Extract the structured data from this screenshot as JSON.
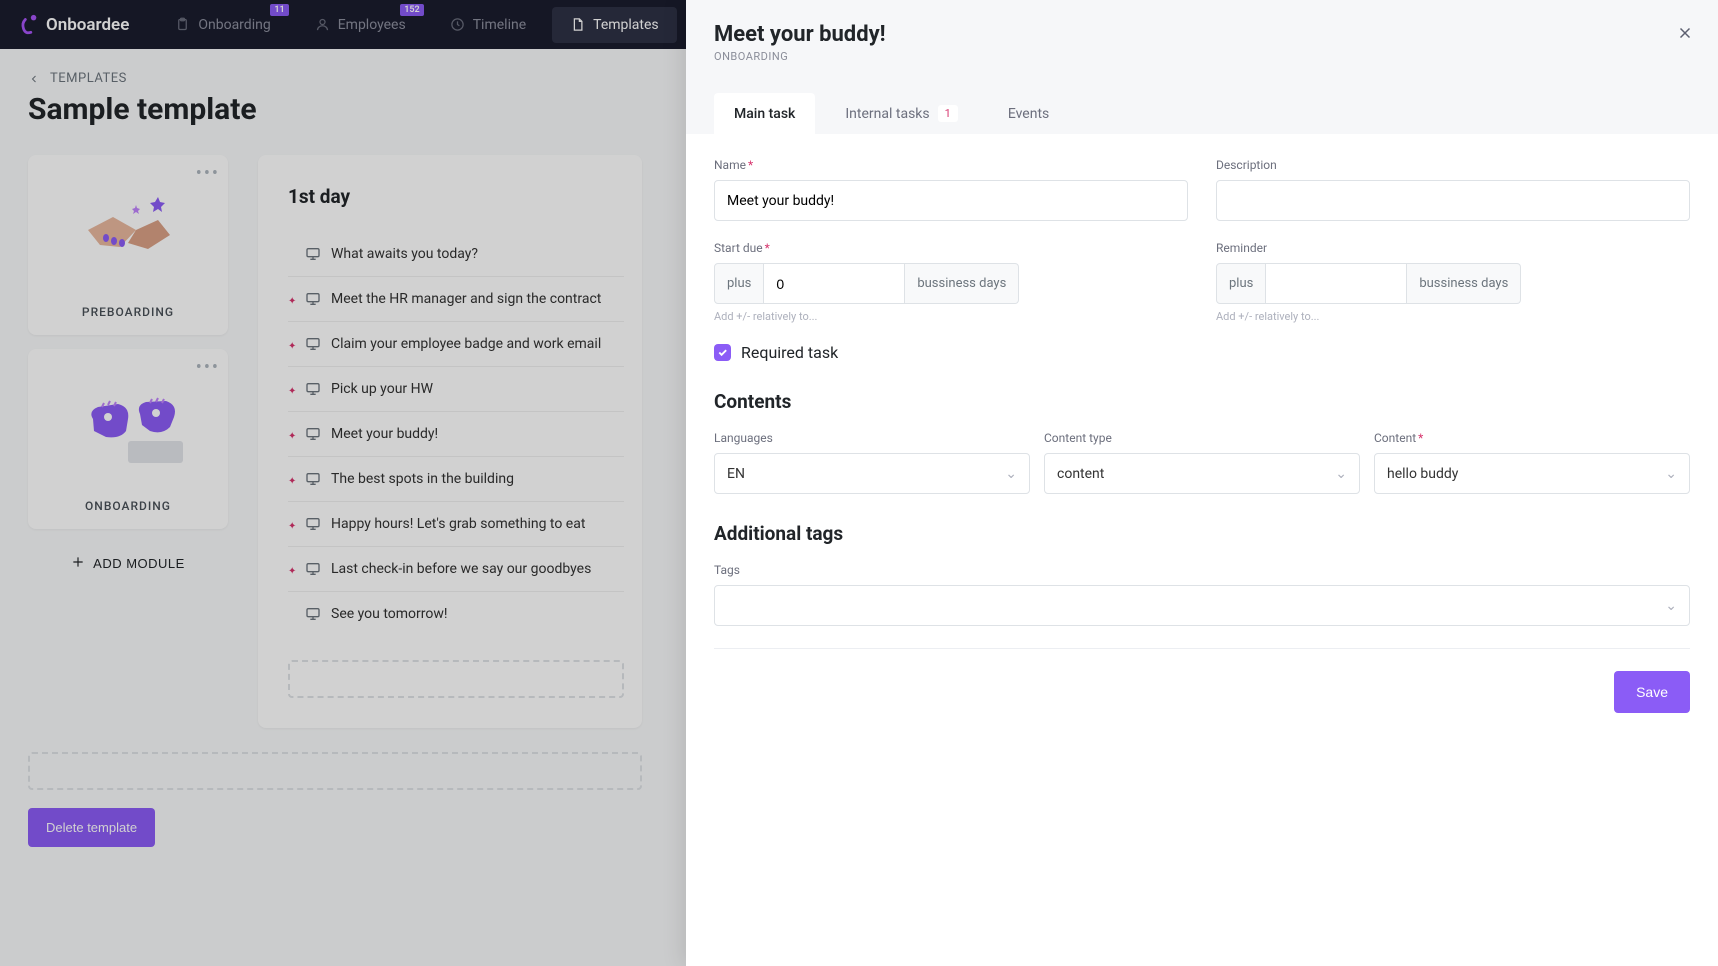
{
  "brand": {
    "name": "Onboardee"
  },
  "nav": {
    "items": [
      {
        "label": "Onboarding",
        "badge": "11"
      },
      {
        "label": "Employees",
        "badge": "152"
      },
      {
        "label": "Timeline",
        "badge": ""
      },
      {
        "label": "Templates",
        "badge": ""
      }
    ]
  },
  "breadcrumb": {
    "back": "TEMPLATES"
  },
  "page": {
    "title": "Sample template"
  },
  "modules": [
    {
      "label": "PREBOARDING"
    },
    {
      "label": "ONBOARDING"
    }
  ],
  "add_module": "ADD MODULE",
  "day": {
    "heading": "1st day"
  },
  "tasks": [
    {
      "text": "What awaits you today?",
      "required": false
    },
    {
      "text": "Meet the HR manager and sign the contract",
      "required": true
    },
    {
      "text": "Claim your employee badge and work email",
      "required": true
    },
    {
      "text": "Pick up your HW",
      "required": true
    },
    {
      "text": "Meet your buddy!",
      "required": true
    },
    {
      "text": "The best spots in the building",
      "required": true
    },
    {
      "text": "Happy hours! Let's grab something to eat",
      "required": true
    },
    {
      "text": "Last check-in before we say our goodbyes",
      "required": true
    },
    {
      "text": "See you tomorrow!",
      "required": false
    }
  ],
  "delete_template": "Delete template",
  "drawer": {
    "title": "Meet your buddy!",
    "subtitle": "ONBOARDING",
    "tabs": [
      {
        "label": "Main task",
        "badge": ""
      },
      {
        "label": "Internal tasks",
        "badge": "1"
      },
      {
        "label": "Events",
        "badge": ""
      }
    ],
    "form": {
      "name_label": "Name",
      "name_value": "Meet your buddy!",
      "desc_label": "Description",
      "desc_value": "",
      "startdue_label": "Start due",
      "startdue_prefix": "plus",
      "startdue_value": "0",
      "startdue_suffix": "bussiness days",
      "startdue_helper": "Add +/- relatively to...",
      "reminder_label": "Reminder",
      "reminder_prefix": "plus",
      "reminder_value": "",
      "reminder_suffix": "bussiness days",
      "reminder_helper": "Add +/- relatively to...",
      "required_label": "Required task",
      "contents_heading": "Contents",
      "languages_label": "Languages",
      "languages_value": "EN",
      "ctype_label": "Content type",
      "ctype_value": "content",
      "content_label": "Content",
      "content_value": "hello buddy",
      "tags_heading": "Additional tags",
      "tags_label": "Tags",
      "save": "Save"
    }
  }
}
